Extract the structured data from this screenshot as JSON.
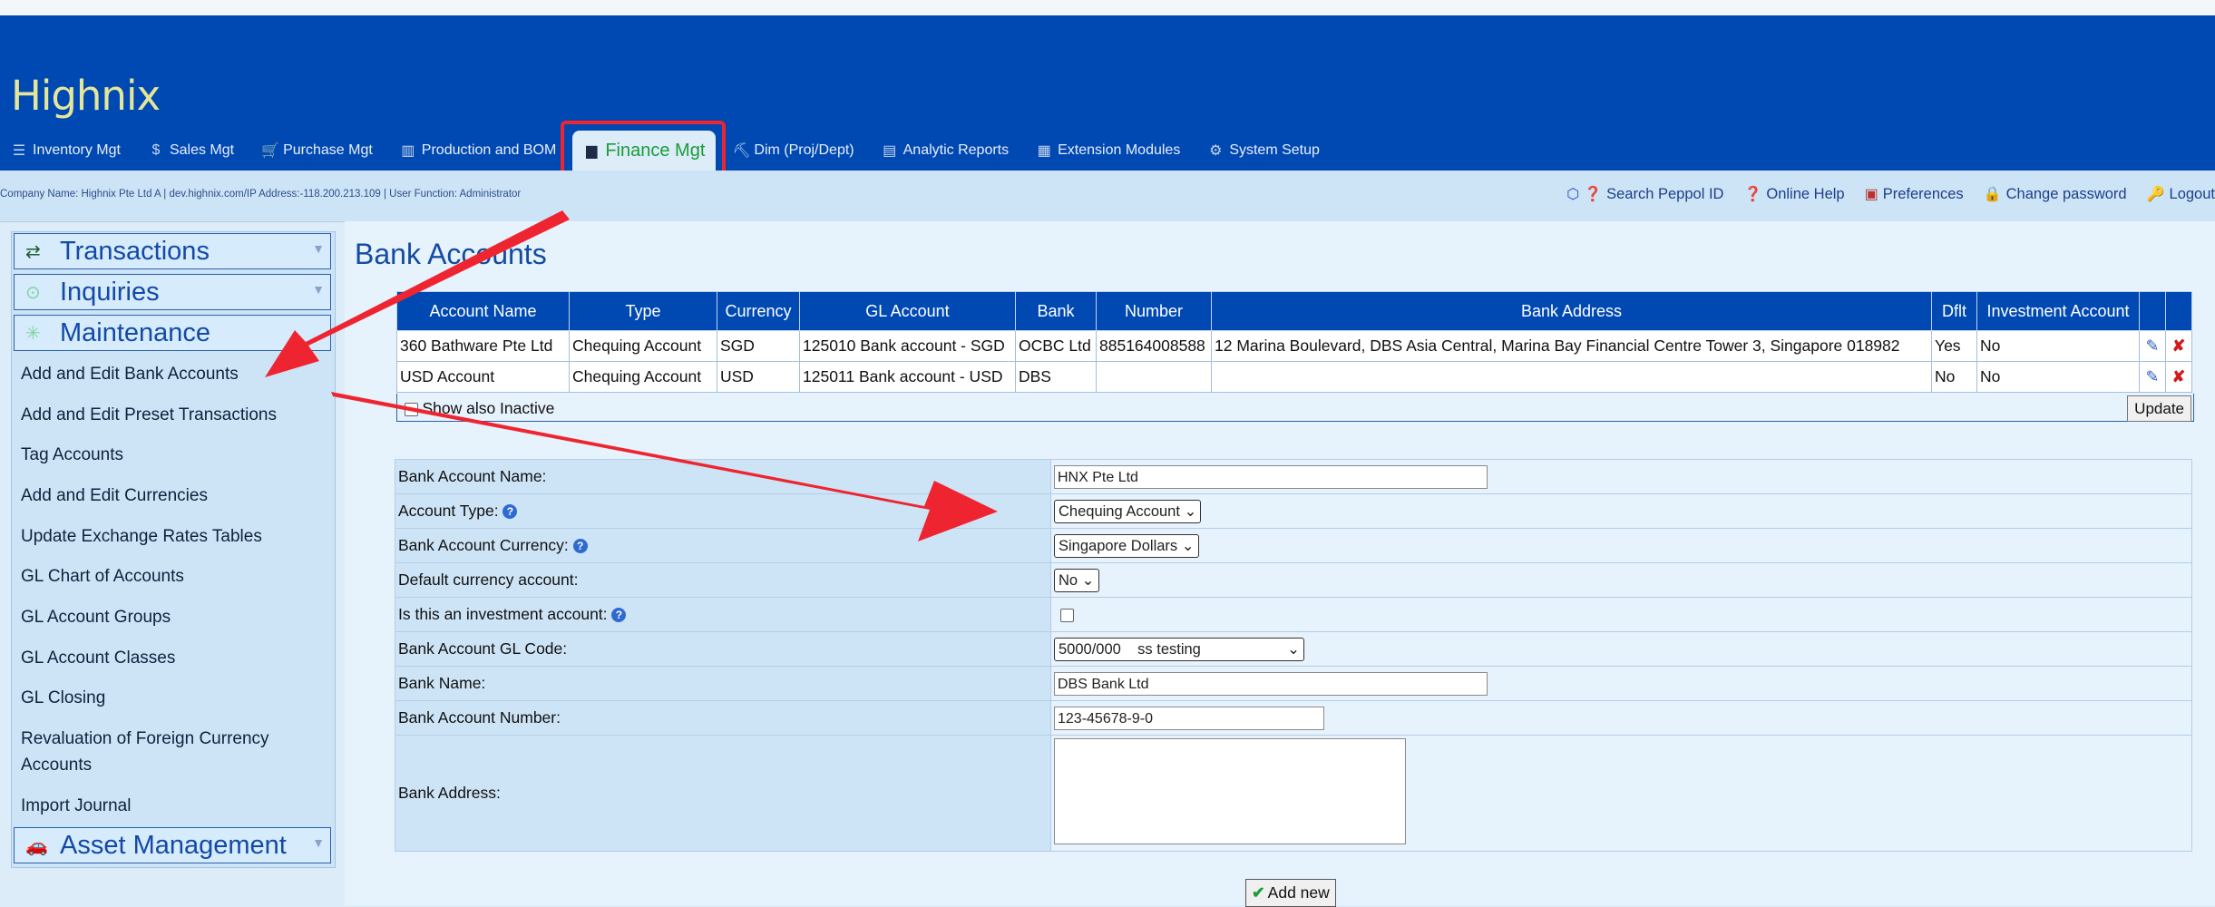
{
  "app": {
    "name": "Highnix"
  },
  "menu": [
    {
      "icon": "☰",
      "label": "Inventory Mgt",
      "u": "I",
      "rest": "nventory Mgt"
    },
    {
      "icon": "$",
      "label": "Sales Mgt",
      "u": "",
      "rest": "Sales Mgt"
    },
    {
      "icon": "🛒",
      "label": "Purchase Mgt",
      "u": "",
      "rest": "Purchase Mgt"
    },
    {
      "icon": "▥",
      "label": "Production and BOM",
      "u": "P",
      "rest": "roduction and BOM"
    },
    {
      "icon": "📶",
      "label": "Finance Mgt",
      "active": true
    },
    {
      "icon": "⛏",
      "label": "Dim (Proj/Dept)",
      "u": "",
      "rest": "Dim (Proj/Dept)"
    },
    {
      "icon": "▤",
      "label": "Analytic Reports",
      "u": "",
      "rest": "Analytic Reports"
    },
    {
      "icon": "▦",
      "label": "Extension Modules",
      "u": "",
      "rest": "Extension Modules"
    },
    {
      "icon": "⚙",
      "label": "System Setup",
      "u": "",
      "rest": "System Setup"
    }
  ],
  "info": {
    "company": "Company Name: Highnix Pte Ltd A | dev.highnix.com/IP Address:-118.200.213.109 | User Function: Administrator"
  },
  "toplinks": [
    "Search Peppol ID",
    "Online Help",
    "Preferences",
    "Change password",
    "Logout"
  ],
  "sidebar": {
    "sections": [
      "Transactions",
      "Inquiries",
      "Maintenance",
      "Asset Management"
    ],
    "items": [
      "Add and Edit Bank Accounts",
      "Add and Edit Preset Transactions",
      "Tag Accounts",
      "Add and Edit Currencies",
      "Update Exchange Rates Tables",
      "GL Chart of Accounts",
      "GL Account Groups",
      "GL Account Classes",
      "GL Closing",
      "Revaluation of Foreign Currency Accounts",
      "Import Journal"
    ]
  },
  "page": {
    "title": "Bank Accounts"
  },
  "table": {
    "headers": [
      "Account Name",
      "Type",
      "Currency",
      "GL Account",
      "Bank",
      "Number",
      "Bank Address",
      "Dflt",
      "Investment Account"
    ],
    "rows": [
      [
        "360 Bathware Pte Ltd",
        "Chequing Account",
        "SGD",
        "125010 Bank account - SGD",
        "OCBC Ltd",
        "885164008588",
        "12 Marina Boulevard, DBS Asia Central, Marina Bay Financial Centre Tower 3, Singapore 018982",
        "Yes",
        "No"
      ],
      [
        "USD Account",
        "Chequing Account",
        "USD",
        "125011 Bank account - USD",
        "DBS",
        "",
        "",
        "No",
        "No"
      ]
    ],
    "show_inactive": "Show also Inactive",
    "update": "Update"
  },
  "form": {
    "labels": [
      "Bank Account Name:",
      "Account Type:",
      "Bank Account Currency:",
      "Default currency account:",
      "Is this an investment account:",
      "Bank Account GL Code:",
      "Bank Name:",
      "Bank Account Number:",
      "Bank Address:"
    ],
    "account_name": "HNX Pte Ltd",
    "account_type": "Chequing Account",
    "currency": "Singapore Dollars",
    "default_currency": "No",
    "gl_code": "5000/000    ss testing",
    "bank_name": "DBS Bank Ltd",
    "account_number": "123-45678-9-0",
    "add_new": "Add new"
  },
  "colors": {
    "brand": "#0049b3",
    "active_tab": "#1a9c3a",
    "annotation": "#ee2530"
  }
}
